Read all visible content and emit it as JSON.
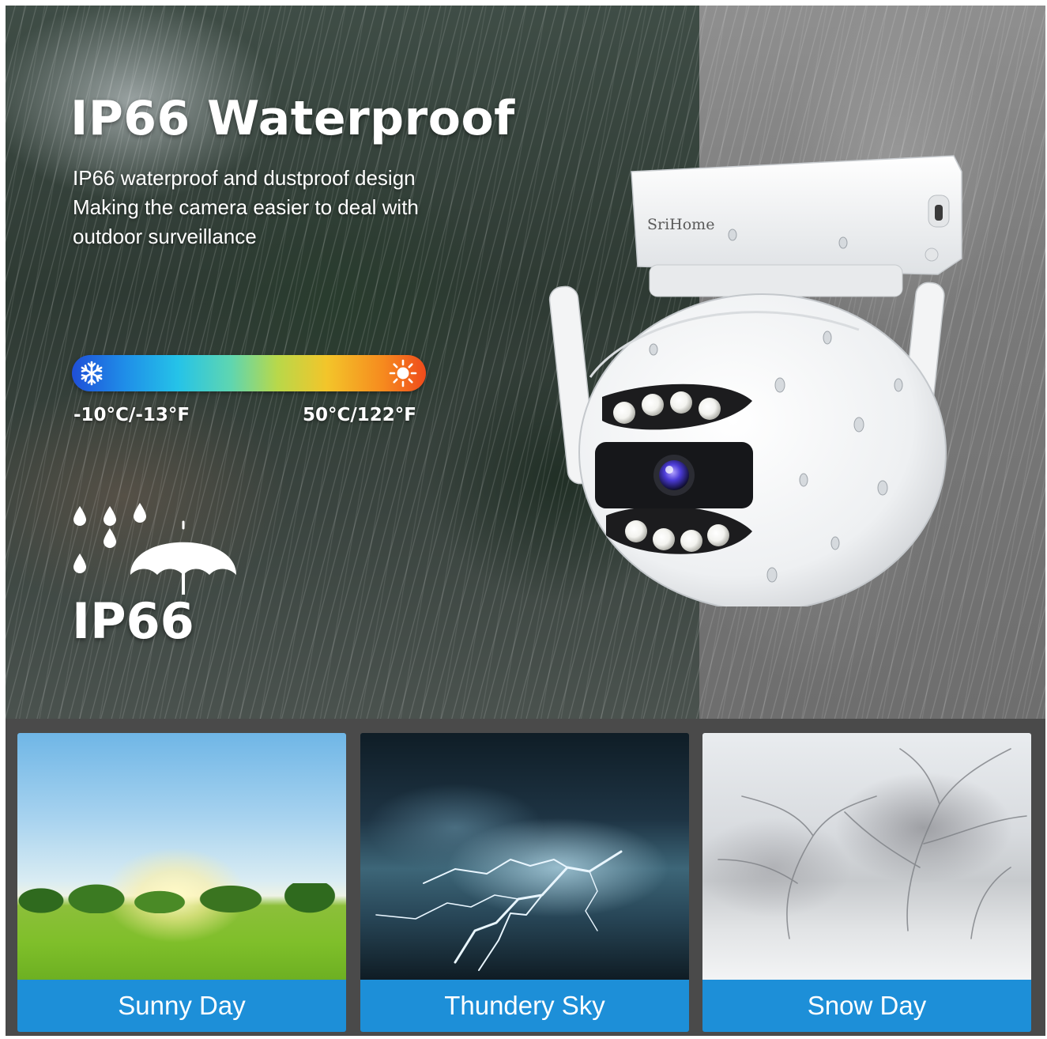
{
  "hero": {
    "title": "IP66 Waterproof",
    "description_lines": [
      "IP66 waterproof and dustproof design",
      "Making the camera easier to deal with",
      "outdoor surveillance"
    ],
    "temperature": {
      "min_label": "-10°C/-13°F",
      "max_label": "50°C/122°F",
      "min_icon": "snowflake-icon",
      "max_icon": "sun-icon"
    },
    "rating_icon": "rain-umbrella-icon",
    "rating_label": "IP66",
    "camera_brand": "SriHome"
  },
  "conditions": [
    {
      "label": "Sunny Day",
      "image": "sunny-field-image"
    },
    {
      "label": "Thundery Sky",
      "image": "lightning-storm-image"
    },
    {
      "label": "Snow Day",
      "image": "snowy-trees-image"
    }
  ],
  "colors": {
    "caption_background": "#1d8fd8",
    "frame_background": "#4a4a4a",
    "bar_cold": "#1f4fd8",
    "bar_hot": "#ef4b1c"
  }
}
